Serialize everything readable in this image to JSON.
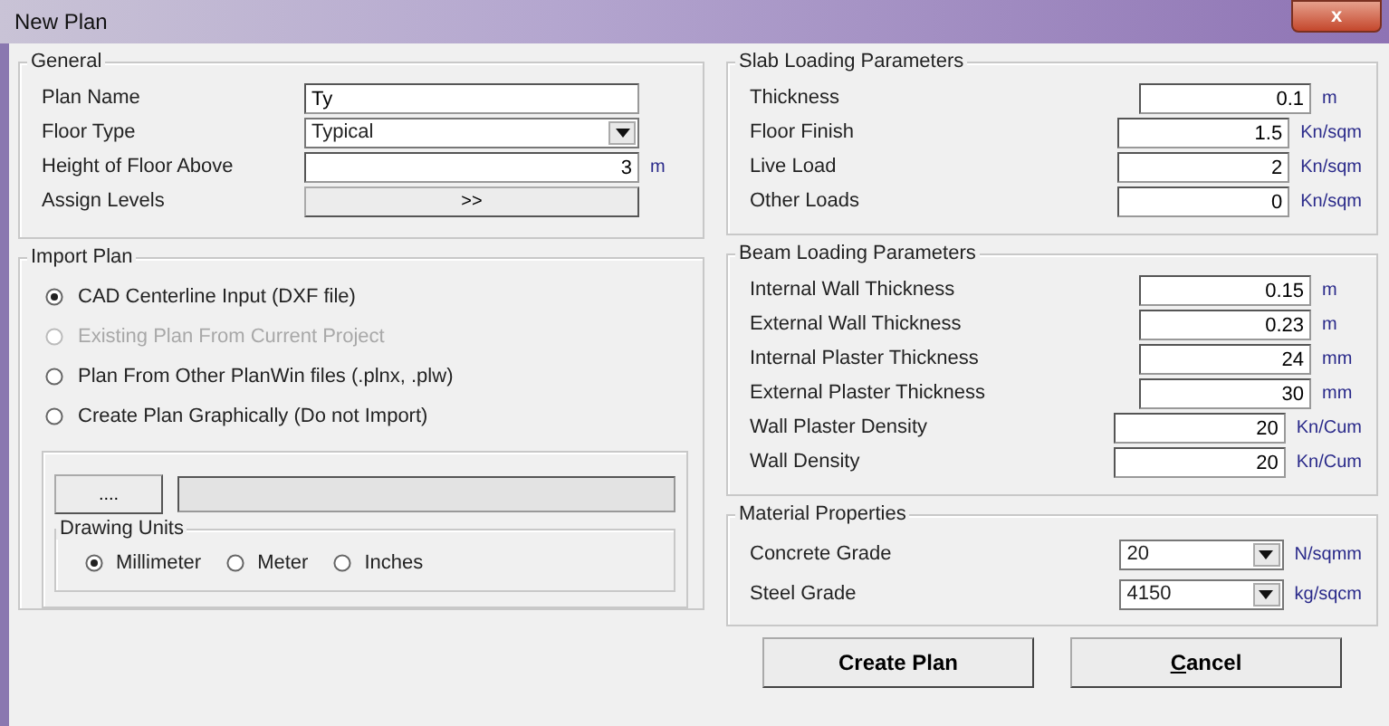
{
  "window": {
    "title": "New Plan",
    "close": "x"
  },
  "general": {
    "title": "General",
    "fields": [
      {
        "kind": "text",
        "label": "Plan Name",
        "value": "Ty"
      },
      {
        "kind": "select",
        "label": "Floor Type",
        "value": "Typical"
      },
      {
        "kind": "number",
        "label": "Height of Floor Above",
        "value": "3",
        "unit": "m"
      },
      {
        "kind": "button",
        "label": "Assign Levels",
        "button": ">>"
      }
    ]
  },
  "import_plan": {
    "title": "Import Plan",
    "options": [
      {
        "label": "CAD Centerline Input (DXF file)",
        "selected": true,
        "disabled": false
      },
      {
        "label": "Existing Plan From Current Project",
        "selected": false,
        "disabled": true
      },
      {
        "label": "Plan From Other PlanWin files  (.plnx, .plw)",
        "selected": false,
        "disabled": false
      },
      {
        "label": "Create Plan Graphically (Do not Import)",
        "selected": false,
        "disabled": false
      }
    ],
    "browse_button": "....",
    "path_disabled": true,
    "drawing_units": {
      "title": "Drawing Units",
      "options": [
        {
          "label": "Millimeter",
          "selected": true
        },
        {
          "label": "Meter",
          "selected": false
        },
        {
          "label": "Inches",
          "selected": false
        }
      ]
    }
  },
  "slab": {
    "title": "Slab Loading Parameters",
    "fields": [
      {
        "kind": "number",
        "label": "Thickness",
        "value": "0.1",
        "unit": "m"
      },
      {
        "kind": "number",
        "label": "Floor Finish",
        "value": "1.5",
        "unit": "Kn/sqm"
      },
      {
        "kind": "number",
        "label": "Live Load",
        "value": "2",
        "unit": "Kn/sqm"
      },
      {
        "kind": "number",
        "label": "Other Loads",
        "value": "0",
        "unit": "Kn/sqm"
      }
    ]
  },
  "beam": {
    "title": "Beam Loading Parameters",
    "fields": [
      {
        "kind": "number",
        "label": "Internal Wall Thickness",
        "value": "0.15",
        "unit": "m"
      },
      {
        "kind": "number",
        "label": "External Wall Thickness",
        "value": "0.23",
        "unit": "m"
      },
      {
        "kind": "number",
        "label": "Internal Plaster Thickness",
        "value": "24",
        "unit": "mm"
      },
      {
        "kind": "number",
        "label": "External Plaster Thickness",
        "value": "30",
        "unit": "mm"
      },
      {
        "kind": "number",
        "label": "Wall Plaster Density",
        "value": "20",
        "unit": "Kn/Cum"
      },
      {
        "kind": "number",
        "label": "Wall Density",
        "value": "20",
        "unit": "Kn/Cum"
      }
    ]
  },
  "material": {
    "title": "Material Properties",
    "fields": [
      {
        "kind": "select",
        "label": "Concrete Grade",
        "value": "20",
        "unit": "N/sqmm"
      },
      {
        "kind": "select",
        "label": "Steel Grade",
        "value": "4150",
        "unit": "kg/sqcm"
      }
    ]
  },
  "buttons": [
    {
      "label": "Create Plan",
      "access_key": false
    },
    {
      "label": "Cancel",
      "access_key": true
    }
  ]
}
